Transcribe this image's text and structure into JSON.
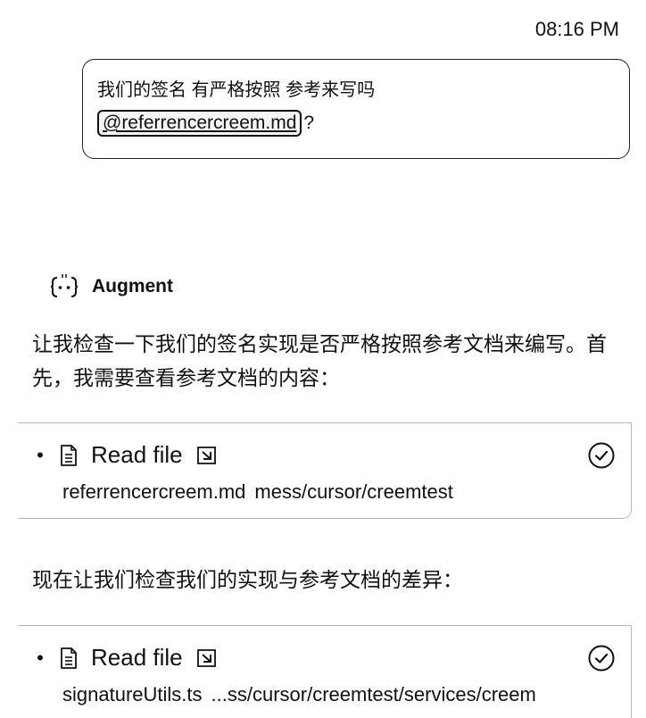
{
  "timestamp": "08:16 PM",
  "user_message": {
    "line1": "我们的签名 有严格按照 参考来写吗",
    "mention": "@referrencercreem.md",
    "suffix": "?"
  },
  "agent": {
    "name": "Augment",
    "icon": "augment-bracket-icon"
  },
  "paragraphs": [
    "让我检查一下我们的签名实现是否严格按照参考文档来编写。首先，我需要查看参考文档的内容：",
    "现在让我们检查我们的实现与参考文档的差异："
  ],
  "tool_calls": [
    {
      "label": "Read file",
      "file": "referrencercreem.md",
      "path": "mess/cursor/creemtest",
      "status": "done"
    },
    {
      "label": "Read file",
      "file": "signatureUtils.ts",
      "path": "...ss/cursor/creemtest/services/creem",
      "status": "done"
    }
  ]
}
